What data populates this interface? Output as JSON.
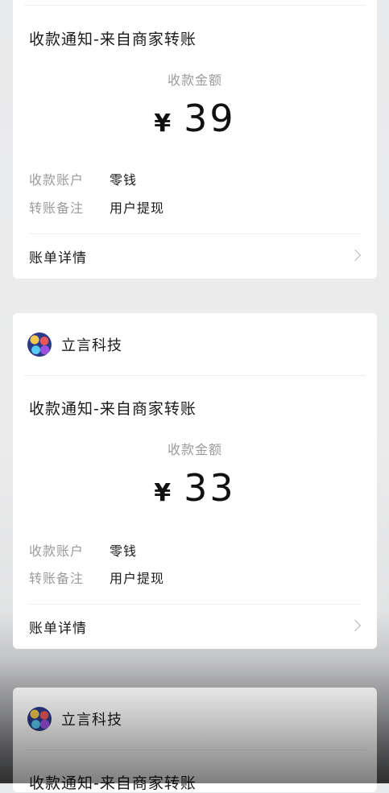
{
  "cards": [
    {
      "merchant": "",
      "title": "收款通知-来自商家转账",
      "amount_label": "收款金额",
      "currency": "¥",
      "amount": "39",
      "account_label": "收款账户",
      "account_value": "零钱",
      "note_label": "转账备注",
      "note_value": "用户提现",
      "detail_label": "账单详情"
    },
    {
      "merchant": "立言科技",
      "title": "收款通知-来自商家转账",
      "amount_label": "收款金额",
      "currency": "¥",
      "amount": "33",
      "account_label": "收款账户",
      "account_value": "零钱",
      "note_label": "转账备注",
      "note_value": "用户提现",
      "detail_label": "账单详情"
    },
    {
      "merchant": "立言科技",
      "title": "收款通知-来自商家转账"
    }
  ]
}
